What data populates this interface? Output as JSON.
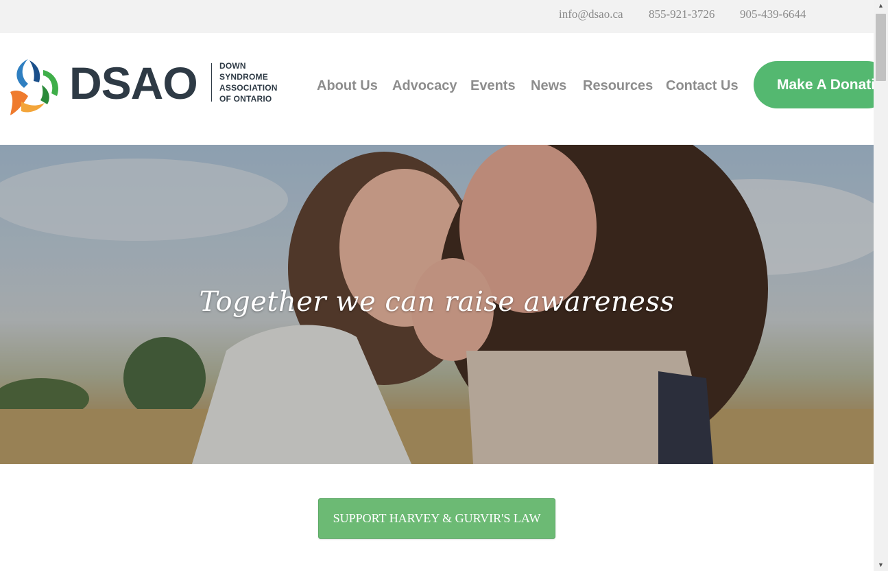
{
  "contact": {
    "email": "info@dsao.ca",
    "phone_1": "855-921-3726",
    "phone_2": "905-439-6644"
  },
  "logo": {
    "wordmark": "DSAO",
    "tagline": [
      "DOWN",
      "SYNDROME",
      "ASSOCIATION",
      "OF ONTARIO"
    ],
    "icon": "dsao-trefoil-logo"
  },
  "nav": {
    "items": [
      "About Us",
      "Advocacy",
      "Events",
      "News",
      "Resources",
      "Contact Us"
    ]
  },
  "donate_button": "Make A Donation",
  "hero": {
    "headline": "Together we can raise awareness",
    "image": "two-girls-cheek-to-cheek-in-wheat-field-photo"
  },
  "cta_button": "SUPPORT HARVEY & GURVIR'S LAW",
  "scrollbar": {
    "up_icon": "arrow-up-icon",
    "down_icon": "arrow-down-icon"
  },
  "colors": {
    "brand_green": "#54b870",
    "cta_green": "#6cba74",
    "logo_navy": "#2e3a45",
    "nav_text": "#8d8d8d",
    "topbar_bg": "#f2f2f2"
  }
}
